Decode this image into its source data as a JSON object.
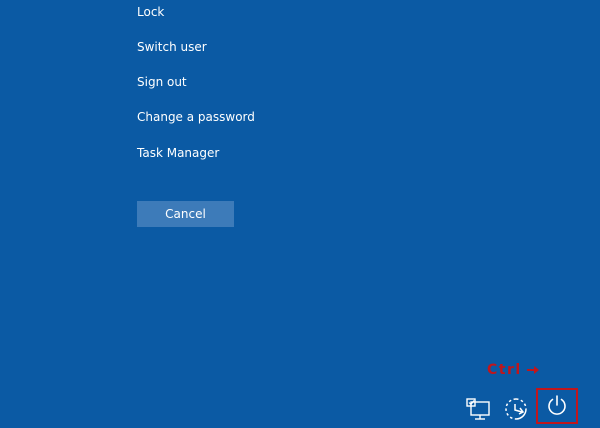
{
  "menu": {
    "items": [
      {
        "label": "Lock"
      },
      {
        "label": "Switch user"
      },
      {
        "label": "Sign out"
      },
      {
        "label": "Change a password"
      },
      {
        "label": "Task Manager"
      }
    ]
  },
  "cancel_button": {
    "label": "Cancel"
  },
  "annotation": {
    "ctrl_label": "Ctrl",
    "ctrl_icon": "arrow-right-icon",
    "color": "#c0161c"
  },
  "tray": {
    "network_icon": "network-icon",
    "ease_of_access_icon": "ease-of-access-icon",
    "power_icon": "power-icon"
  },
  "colors": {
    "background": "#0b5aa4",
    "button": "#3d7bb9",
    "text": "#ffffff",
    "highlight": "#c0161c"
  }
}
